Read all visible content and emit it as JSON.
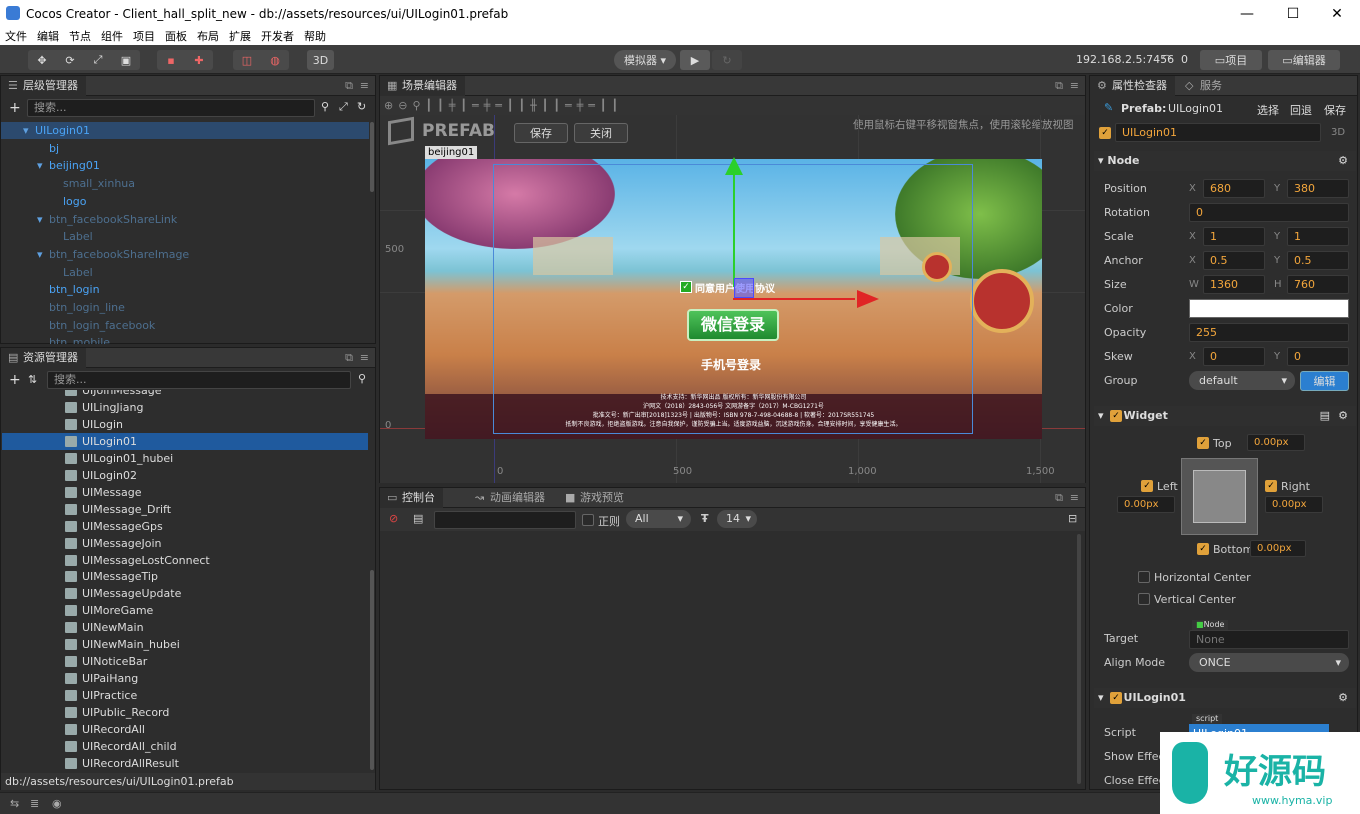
{
  "window": {
    "title": "Cocos Creator - Client_hall_split_new - db://assets/resources/ui/UILogin01.prefab",
    "min": "—",
    "max": "☐",
    "close": "✕"
  },
  "menu": [
    "文件",
    "编辑",
    "节点",
    "组件",
    "项目",
    "面板",
    "布局",
    "扩展",
    "开发者",
    "帮助"
  ],
  "toolbar": {
    "btn_3d": "3D",
    "simulator": "模拟器 ▾",
    "ip": "192.168.2.5:7456",
    "conn_count": "0",
    "project_btn": "项目",
    "editor_btn": "编辑器"
  },
  "hierarchy": {
    "tab": "层级管理器",
    "search_placeholder": "搜索...",
    "nodes": [
      {
        "label": "UILogin01",
        "indent": 0,
        "arrow": "▾",
        "style": "selected"
      },
      {
        "label": "bj",
        "indent": 1,
        "arrow": "",
        "style": "normal"
      },
      {
        "label": "beijing01",
        "indent": 1,
        "arrow": "▾",
        "style": "normal"
      },
      {
        "label": "small_xinhua",
        "indent": 2,
        "arrow": "",
        "style": "disabled"
      },
      {
        "label": "logo",
        "indent": 2,
        "arrow": "",
        "style": "normal"
      },
      {
        "label": "btn_facebookShareLink",
        "indent": 1,
        "arrow": "▾",
        "style": "disabled"
      },
      {
        "label": "Label",
        "indent": 2,
        "arrow": "",
        "style": "disabled"
      },
      {
        "label": "btn_facebookShareImage",
        "indent": 1,
        "arrow": "▾",
        "style": "disabled"
      },
      {
        "label": "Label",
        "indent": 2,
        "arrow": "",
        "style": "disabled"
      },
      {
        "label": "btn_login",
        "indent": 1,
        "arrow": "",
        "style": "normal"
      },
      {
        "label": "btn_login_line",
        "indent": 1,
        "arrow": "",
        "style": "disabled"
      },
      {
        "label": "btn_login_facebook",
        "indent": 1,
        "arrow": "",
        "style": "disabled"
      },
      {
        "label": "btn_mobile",
        "indent": 1,
        "arrow": "",
        "style": "disabled"
      }
    ]
  },
  "assets": {
    "tab": "资源管理器",
    "search_placeholder": "搜索...",
    "items": [
      "UIJoinMessage",
      "UILingJiang",
      "UILogin",
      "UILogin01",
      "UILogin01_hubei",
      "UILogin02",
      "UIMessage",
      "UIMessage_Drift",
      "UIMessageGps",
      "UIMessageJoin",
      "UIMessageLostConnect",
      "UIMessageTip",
      "UIMessageUpdate",
      "UIMoreGame",
      "UINewMain",
      "UINewMain_hubei",
      "UINoticeBar",
      "UIPaiHang",
      "UIPractice",
      "UIPublic_Record",
      "UIRecordAll",
      "UIRecordAll_child",
      "UIRecordAllResult"
    ],
    "selected": "UILogin01",
    "status_path": "db://assets/resources/ui/UILogin01.prefab"
  },
  "scene": {
    "tab": "场景编辑器",
    "prefab_label": "PREFAB",
    "save": "保存",
    "close": "关闭",
    "hint": "使用鼠标右键平移视窗焦点，使用滚轮缩放视图",
    "node_label": "beijing01",
    "y_ticks": [
      "500",
      "0"
    ],
    "x_ticks": [
      "0",
      "500",
      "1,000",
      "1,500"
    ],
    "game": {
      "agree": "同意用户使用协议",
      "wechat": "微信登录",
      "phone": "手机号登录",
      "footer": [
        "技术支持：新华网出品 版权所有：新华网股份有限公司",
        "沪网文（2018）2843-056号 文网游备字（2017）M-CBG1271号",
        "批准文号：新广出审[2018]1323号 | 出版物号：ISBN 978-7-498-04688-8 | 软著号：2017SR551745",
        "抵制不良游戏，拒绝盗版游戏。注意自我保护，谨防受骗上当。适度游戏益脑，沉迷游戏伤身。合理安排时间，享受健康生活。"
      ]
    }
  },
  "console": {
    "tabs": [
      "控制台",
      "动画编辑器",
      "游戏预览"
    ],
    "regex_label": "正则",
    "filter": "All",
    "font_size": "14"
  },
  "inspector": {
    "tabs": [
      "属性检查器",
      "服务"
    ],
    "prefab_label": "Prefab:",
    "prefab_name": "UILogin01",
    "actions": [
      "选择",
      "回退",
      "保存"
    ],
    "node_name": "UILogin01",
    "badge_3d": "3D",
    "node_section": "Node",
    "position": {
      "label": "Position",
      "x": "680",
      "y": "380"
    },
    "rotation": {
      "label": "Rotation",
      "v": "0"
    },
    "scale": {
      "label": "Scale",
      "x": "1",
      "y": "1"
    },
    "anchor": {
      "label": "Anchor",
      "x": "0.5",
      "y": "0.5"
    },
    "size": {
      "label": "Size",
      "w": "1360",
      "h": "760"
    },
    "color": {
      "label": "Color",
      "value": "#ffffff"
    },
    "opacity": {
      "label": "Opacity",
      "v": "255"
    },
    "skew": {
      "label": "Skew",
      "x": "0",
      "y": "0"
    },
    "group": {
      "label": "Group",
      "value": "default",
      "edit": "编辑"
    },
    "widget_section": "Widget",
    "widget": {
      "top": "Top",
      "top_v": "0.00px",
      "left": "Left",
      "left_v": "0.00px",
      "right": "Right",
      "right_v": "0.00px",
      "bottom": "Bottom",
      "bottom_v": "0.00px",
      "hcenter": "Horizontal Center",
      "vcenter": "Vertical Center",
      "target_label": "Target",
      "target_tag": "Node",
      "target_v": "None",
      "align_label": "Align Mode",
      "align_v": "ONCE"
    },
    "script_section": "UILogin01",
    "script": {
      "label": "Script",
      "tag": "script",
      "value": "UILogin01"
    },
    "show_effect": "Show Effect",
    "close_effect": "Close Effect"
  },
  "watermark": {
    "text": "好源码",
    "url": "www.hyma.vip"
  }
}
